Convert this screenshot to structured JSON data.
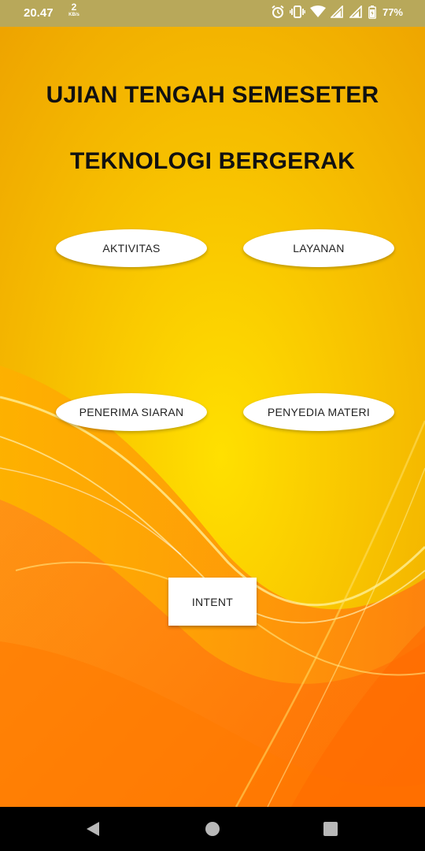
{
  "status_bar": {
    "time": "20.47",
    "net_speed_value": "2",
    "net_speed_unit": "KB/s",
    "battery": "77%",
    "icons": [
      "alarm-icon",
      "vibrate-icon",
      "wifi-icon",
      "signal-icon",
      "signal-icon",
      "battery-icon"
    ]
  },
  "title": {
    "line1": "UJIAN TENGAH SEMESETER",
    "line2": "TEKNOLOGI BERGERAK"
  },
  "buttons": {
    "aktivitas": "AKTIVITAS",
    "layanan": "LAYANAN",
    "penerima_siaran": "PENERIMA SIARAN",
    "penyedia_materi": "PENYEDIA MATERI",
    "intent": "INTENT"
  },
  "nav_bar": {
    "icons": [
      "back-icon",
      "home-icon",
      "recents-icon"
    ]
  },
  "colors": {
    "background_primary": "#f3b300",
    "background_highlight": "#ffd800",
    "background_accent": "#ff7a10",
    "button_background": "#ffffff",
    "text_dark": "#111111"
  }
}
